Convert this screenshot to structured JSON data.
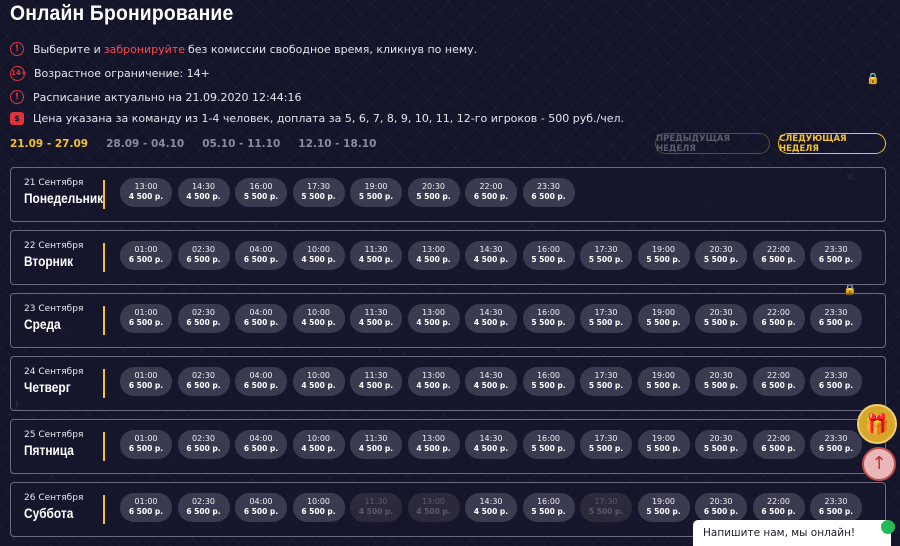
{
  "title": "Онлайн Бронирование",
  "info": {
    "line1_before": "Выберите и",
    "line1_highlight": "забронируйте",
    "line1_after": "без комиссии свободное время, кликнув по нему.",
    "age_icon": "14+",
    "age": "Возрастное ограничение: 14+",
    "schedule": "Расписание актуально на 21.09.2020 12:44:16",
    "price": "Цена указана за команду из 1-4 человек, доплата за 5, 6, 7, 8, 9, 10, 11, 12-го игроков - 500 руб./чел."
  },
  "weeks": [
    "21.09 - 27.09",
    "28.09 - 04.10",
    "05.10 - 11.10",
    "12.10 - 18.10"
  ],
  "prev_week": "Предыдущая неделя",
  "next_week": "Следующая неделя",
  "days": [
    {
      "date": "21 Сентября",
      "weekday": "Понедельник",
      "slots": [
        [
          "13:00",
          "4 500 р."
        ],
        [
          "14:30",
          "4 500 р."
        ],
        [
          "16:00",
          "5 500 р."
        ],
        [
          "17:30",
          "5 500 р."
        ],
        [
          "19:00",
          "5 500 р."
        ],
        [
          "20:30",
          "5 500 р."
        ],
        [
          "22:00",
          "6 500 р."
        ],
        [
          "23:30",
          "6 500 р."
        ]
      ]
    },
    {
      "date": "22 Сентября",
      "weekday": "Вторник",
      "slots": [
        [
          "01:00",
          "6 500 р."
        ],
        [
          "02:30",
          "6 500 р."
        ],
        [
          "04:00",
          "6 500 р."
        ],
        [
          "10:00",
          "4 500 р."
        ],
        [
          "11:30",
          "4 500 р."
        ],
        [
          "13:00",
          "4 500 р."
        ],
        [
          "14:30",
          "4 500 р."
        ],
        [
          "16:00",
          "5 500 р."
        ],
        [
          "17:30",
          "5 500 р."
        ],
        [
          "19:00",
          "5 500 р."
        ],
        [
          "20:30",
          "5 500 р."
        ],
        [
          "22:00",
          "6 500 р."
        ],
        [
          "23:30",
          "6 500 р."
        ]
      ]
    },
    {
      "date": "23 Сентября",
      "weekday": "Среда",
      "slots": [
        [
          "01:00",
          "6 500 р."
        ],
        [
          "02:30",
          "6 500 р."
        ],
        [
          "04:00",
          "6 500 р."
        ],
        [
          "10:00",
          "4 500 р."
        ],
        [
          "11:30",
          "4 500 р."
        ],
        [
          "13:00",
          "4 500 р."
        ],
        [
          "14:30",
          "4 500 р."
        ],
        [
          "16:00",
          "5 500 р."
        ],
        [
          "17:30",
          "5 500 р."
        ],
        [
          "19:00",
          "5 500 р."
        ],
        [
          "20:30",
          "5 500 р."
        ],
        [
          "22:00",
          "6 500 р."
        ],
        [
          "23:30",
          "6 500 р."
        ]
      ]
    },
    {
      "date": "24 Сентября",
      "weekday": "Четверг",
      "slots": [
        [
          "01:00",
          "6 500 р."
        ],
        [
          "02:30",
          "6 500 р."
        ],
        [
          "04:00",
          "6 500 р."
        ],
        [
          "10:00",
          "4 500 р."
        ],
        [
          "11:30",
          "4 500 р."
        ],
        [
          "13:00",
          "4 500 р."
        ],
        [
          "14:30",
          "4 500 р."
        ],
        [
          "16:00",
          "5 500 р."
        ],
        [
          "17:30",
          "5 500 р."
        ],
        [
          "19:00",
          "5 500 р."
        ],
        [
          "20:30",
          "5 500 р."
        ],
        [
          "22:00",
          "6 500 р."
        ],
        [
          "23:30",
          "6 500 р."
        ]
      ]
    },
    {
      "date": "25 Сентября",
      "weekday": "Пятница",
      "slots": [
        [
          "01:00",
          "6 500 р."
        ],
        [
          "02:30",
          "6 500 р."
        ],
        [
          "04:00",
          "6 500 р."
        ],
        [
          "10:00",
          "4 500 р."
        ],
        [
          "11:30",
          "4 500 р."
        ],
        [
          "13:00",
          "4 500 р."
        ],
        [
          "14:30",
          "4 500 р."
        ],
        [
          "16:00",
          "5 500 р."
        ],
        [
          "17:30",
          "5 500 р."
        ],
        [
          "19:00",
          "5 500 р."
        ],
        [
          "20:30",
          "5 500 р."
        ],
        [
          "22:00",
          "6 500 р."
        ],
        [
          "23:30",
          "6 500 р."
        ]
      ]
    },
    {
      "date": "26 Сентября",
      "weekday": "Суббота",
      "slots": [
        [
          "01:00",
          "6 500 р."
        ],
        [
          "02:30",
          "6 500 р."
        ],
        [
          "04:00",
          "6 500 р."
        ],
        [
          "10:00",
          "6 500 р."
        ],
        [
          "11:30",
          "4 500 р.",
          true
        ],
        [
          "13:00",
          "4 500 р.",
          true
        ],
        [
          "14:30",
          "4 500 р."
        ],
        [
          "16:00",
          "5 500 р."
        ],
        [
          "17:30",
          "5 500 р.",
          true
        ],
        [
          "19:00",
          "5 500 р."
        ],
        [
          "20:30",
          "6 500 р."
        ],
        [
          "22:00",
          "6 500 р."
        ],
        [
          "23:30",
          "6 500 р."
        ]
      ]
    }
  ],
  "chat": "Напишите нам, мы онлайн!"
}
